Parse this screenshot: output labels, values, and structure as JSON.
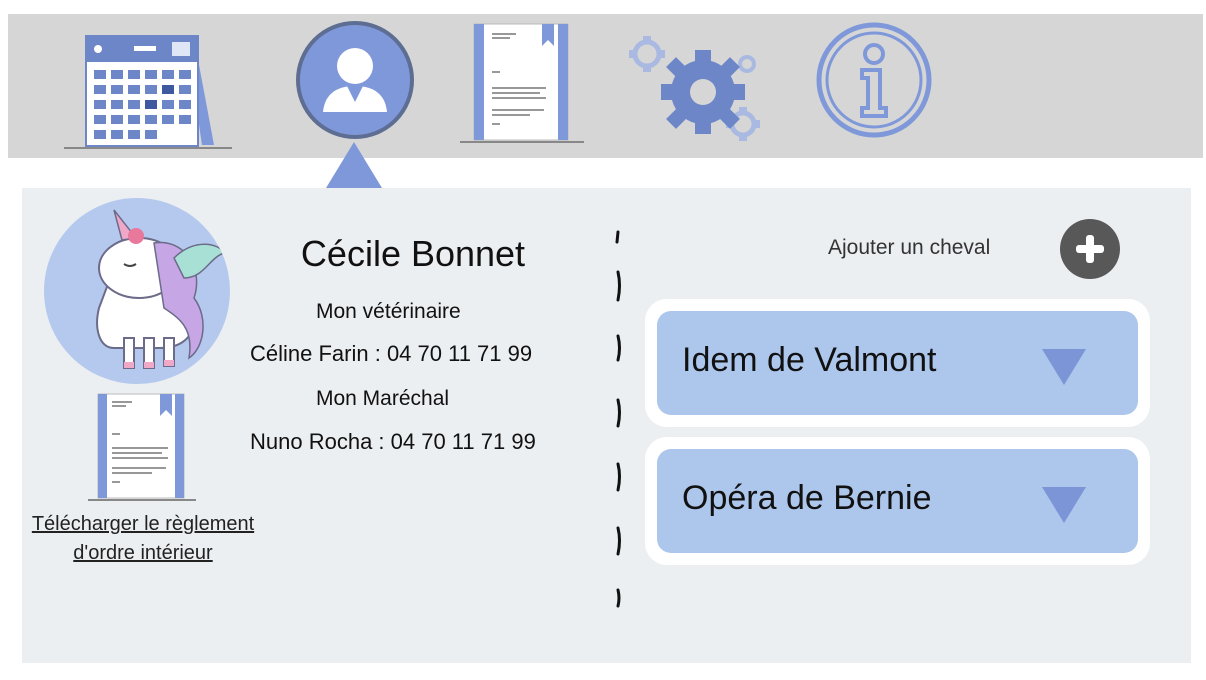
{
  "nav": {
    "items": [
      {
        "name": "calendar-icon",
        "active": false
      },
      {
        "name": "user-profile-icon",
        "active": true
      },
      {
        "name": "document-icon",
        "active": false
      },
      {
        "name": "gears-icon",
        "active": false
      },
      {
        "name": "info-icon",
        "active": false
      }
    ]
  },
  "profile": {
    "owner_name": "Cécile Bonnet",
    "vet_label": "Mon vétérinaire",
    "vet_contact": "Céline Farin  : 04 70 11 71 99",
    "farrier_label": "Mon Maréchal",
    "farrier_contact": "Nuno Rocha  : 04 70 11 71 99",
    "download_line1": "Télécharger le règlement",
    "download_line2": "d'ordre intérieur"
  },
  "horses": {
    "add_label": "Ajouter un cheval",
    "list": [
      {
        "name": "Idem de Valmont"
      },
      {
        "name": "Opéra de Bernie"
      }
    ]
  },
  "colors": {
    "accent": "#7f98d9",
    "card": "#adc6ec",
    "panel": "#eceff2",
    "topbar": "#d6d6d6"
  }
}
